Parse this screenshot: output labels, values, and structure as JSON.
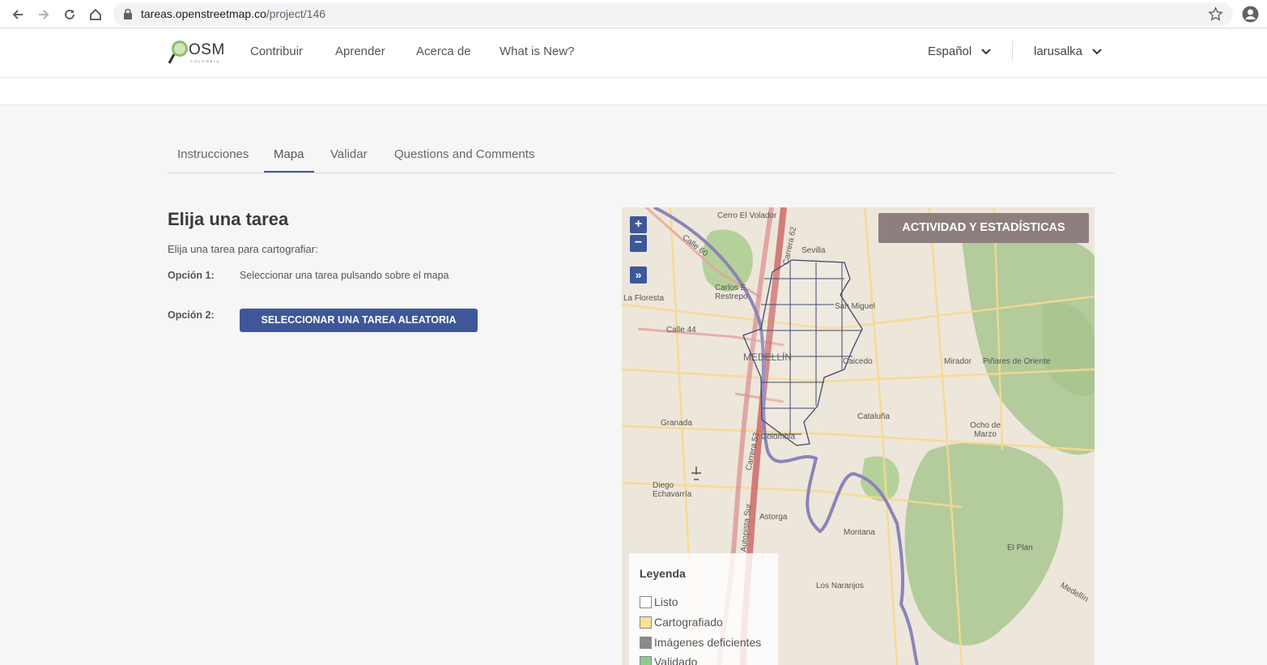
{
  "browser": {
    "url_host": "tareas.openstreetmap.co",
    "url_path": "/project/146"
  },
  "header": {
    "logo_text": "OSM",
    "logo_sub": "COLOMBIA",
    "nav": [
      "Contribuir",
      "Aprender",
      "Acerca de",
      "What is New?"
    ],
    "language": "Español",
    "user": "larusalka"
  },
  "tabs": [
    "Instrucciones",
    "Mapa",
    "Validar",
    "Questions and Comments"
  ],
  "active_tab": "Mapa",
  "task": {
    "title": "Elija una tarea",
    "subtitle": "Elija una tarea para cartografiar:",
    "option1_label": "Opción 1:",
    "option1_text": "Seleccionar una tarea pulsando sobre el mapa",
    "option2_label": "Opción 2:",
    "random_button": "SELECCIONAR UNA TAREA ALEATORIA"
  },
  "map": {
    "zoom_in": "+",
    "zoom_out": "−",
    "expand": "»",
    "activity_button": "ACTIVIDAD Y ESTADÍSTICAS",
    "labels": [
      "Cerro El Volador",
      "Calle 60",
      "Carrera 62",
      "Sevilla",
      "Carlos E. Restrepo",
      "La Floresta",
      "San Miguel",
      "Calle 44",
      "MEDELLÍN",
      "Caicedo",
      "Mirador",
      "Piñares de Oriente",
      "Cataluña",
      "Ocho de Marzo",
      "Granada",
      "Colombia",
      "Carrera 53",
      "Diego Echavarría",
      "Autopista Sur",
      "Astorga",
      "Montana",
      "El Plan",
      "Los Naranjos",
      "Medellín"
    ],
    "legend": {
      "title": "Leyenda",
      "items": [
        {
          "label": "Listo",
          "color": "#ffffff"
        },
        {
          "label": "Cartografiado",
          "color": "#fde293"
        },
        {
          "label": "Imágenes deficientes",
          "color": "#8a8a8a"
        },
        {
          "label": "Validado",
          "color": "#8ec98e"
        }
      ]
    }
  },
  "colors": {
    "primary": "#3e5799",
    "activity": "#8e7f7f"
  }
}
